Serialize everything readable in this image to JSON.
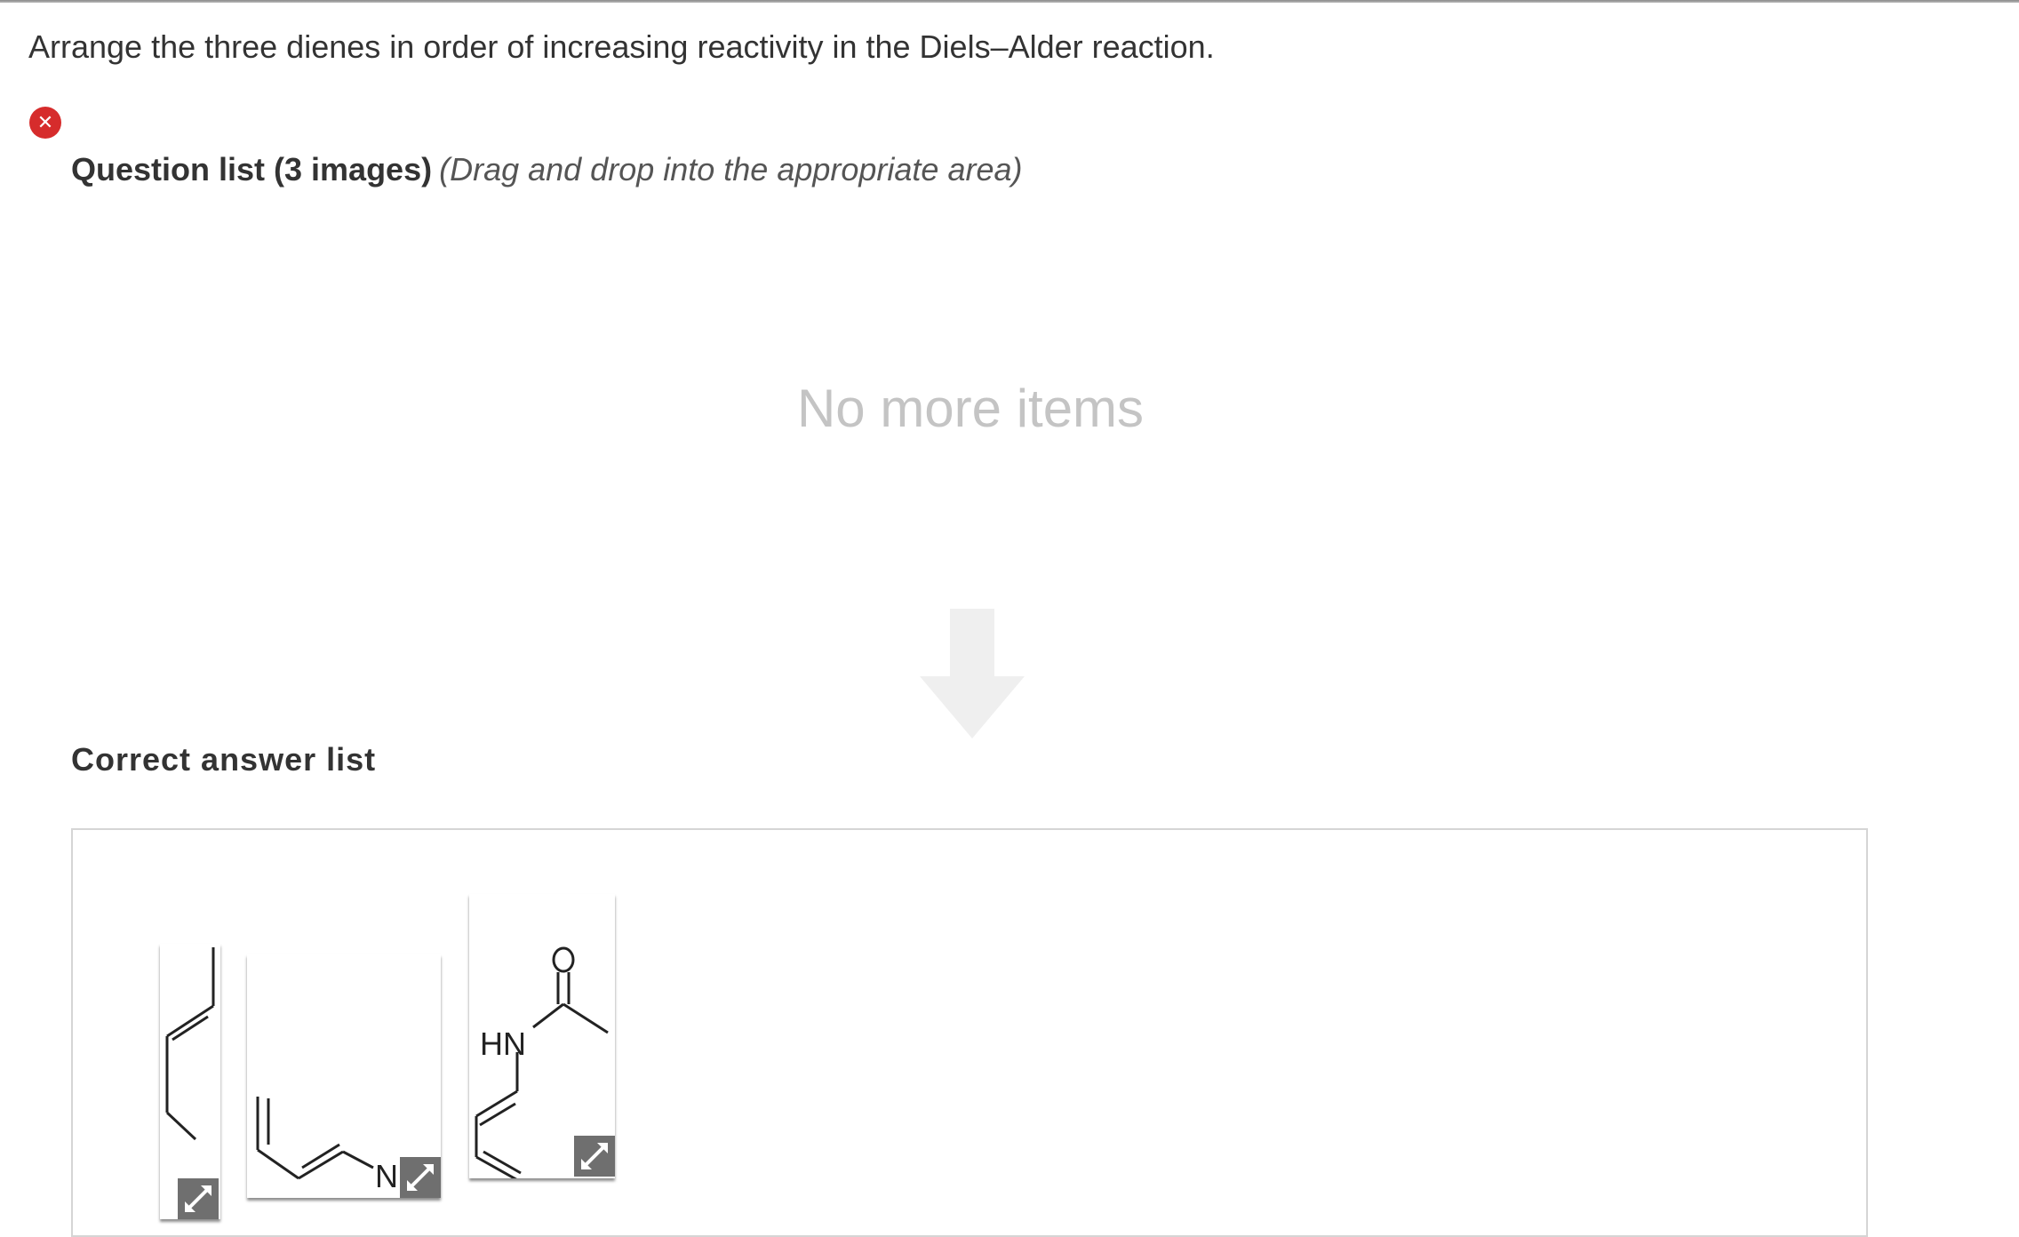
{
  "prompt": "Arrange the three dienes in order of increasing reactivity in the Diels–Alder reaction.",
  "status": {
    "icon": "error-x-icon",
    "color": "#d62c2c"
  },
  "question_list": {
    "heading": "Question list (3 images)",
    "hint": "(Drag and drop into the appropriate area)",
    "empty_text": "No more items"
  },
  "answer_list": {
    "heading": "Correct answer list",
    "items": [
      {
        "name": "diene-1",
        "labels": []
      },
      {
        "name": "diene-2",
        "labels": [
          "NH",
          "2"
        ]
      },
      {
        "name": "diene-3",
        "labels": [
          "HN",
          "O"
        ]
      }
    ]
  }
}
